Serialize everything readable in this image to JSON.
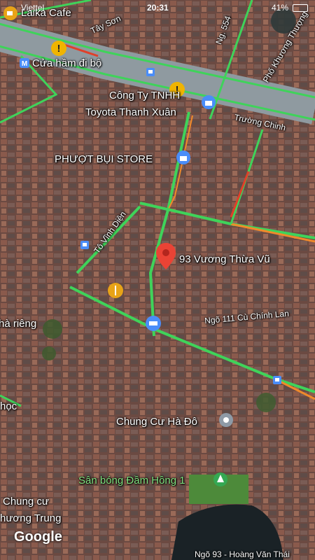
{
  "status_bar": {
    "carrier": "Viettel",
    "time": "20:31",
    "battery": "41%"
  },
  "places": {
    "laika_cafe": "Laika Cafe",
    "tay_son": "Tây Sơn",
    "ng_554": "Ng. 554",
    "pho_khuong_thuong": "Phố Khương Thượng",
    "cua_ham": "Cửa hầm đi bộ",
    "cong_ty": "Công Ty TNHH",
    "toyota": "Toyota Thanh Xuân",
    "truong_chinh": "Trường Chinh",
    "phuot_bui": "PHƯỢT BỤI STORE",
    "to_vinh_dien": "Tô Vĩnh Diện",
    "selected": "93 Vương Thừa Vũ",
    "ngo_111": "Ngõ 111 Cù Chính Lan",
    "ha_rieng": "hà riêng",
    "hoc": "học",
    "chung_cu_ha_do": "Chung Cư Hà Đô",
    "san_bong": "Sân bóng Đầm Hồng 1",
    "chung_cu_1": "Chung cư",
    "chung_cu_2": "hương Trung",
    "ngo_hoang": "Ngõ 93 - Hoàng Văn Thái"
  },
  "attribution": "Google",
  "colors": {
    "traffic_green": "#3fd35a",
    "traffic_orange": "#f08a2a",
    "traffic_red": "#e0402a",
    "pin_red": "#ea4335",
    "pin_blue": "#4a8df8",
    "pin_orange": "#e8a317",
    "pin_green": "#34a853"
  },
  "icons": [
    "coffee-cup-icon",
    "warning-icon",
    "metro-icon",
    "bus-stop-icon",
    "shopping-bag-icon",
    "restaurant-icon",
    "shopping-cart-icon",
    "location-pin-icon",
    "park-icon"
  ]
}
